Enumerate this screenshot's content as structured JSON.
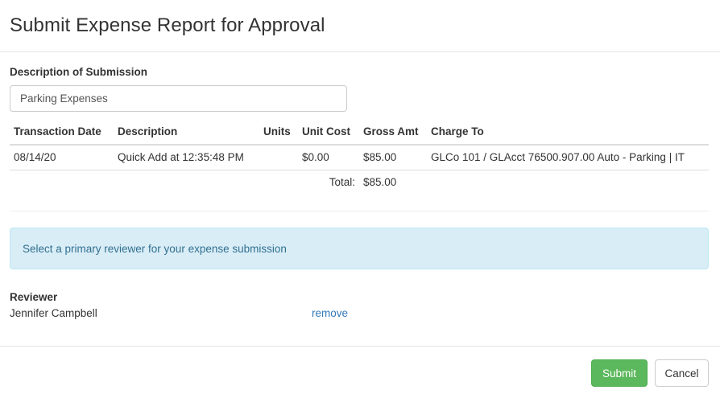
{
  "modal": {
    "title": "Submit Expense Report for Approval"
  },
  "description": {
    "label": "Description of Submission",
    "value": "Parking Expenses"
  },
  "table": {
    "headers": {
      "date": "Transaction Date",
      "description": "Description",
      "units": "Units",
      "unit_cost": "Unit Cost",
      "gross_amt": "Gross Amt",
      "charge_to": "Charge To"
    },
    "rows": [
      {
        "date": "08/14/20",
        "description": "Quick Add at 12:35:48 PM",
        "units": "",
        "unit_cost": "$0.00",
        "gross_amt": "$85.00",
        "charge_to": "GLCo 101 / GLAcct 76500.907.00 Auto - Parking | IT"
      }
    ],
    "total_label": "Total:",
    "total_value": "$85.00"
  },
  "alert": {
    "text": "Select a primary reviewer for your expense submission"
  },
  "reviewer": {
    "label": "Reviewer",
    "name": "Jennifer Campbell",
    "remove_label": "remove"
  },
  "footer": {
    "submit_label": "Submit",
    "cancel_label": "Cancel"
  },
  "colors": {
    "submit_bg": "#5cb85c",
    "alert_bg": "#d9edf7",
    "alert_text": "#31708f",
    "link": "#337ab7"
  }
}
